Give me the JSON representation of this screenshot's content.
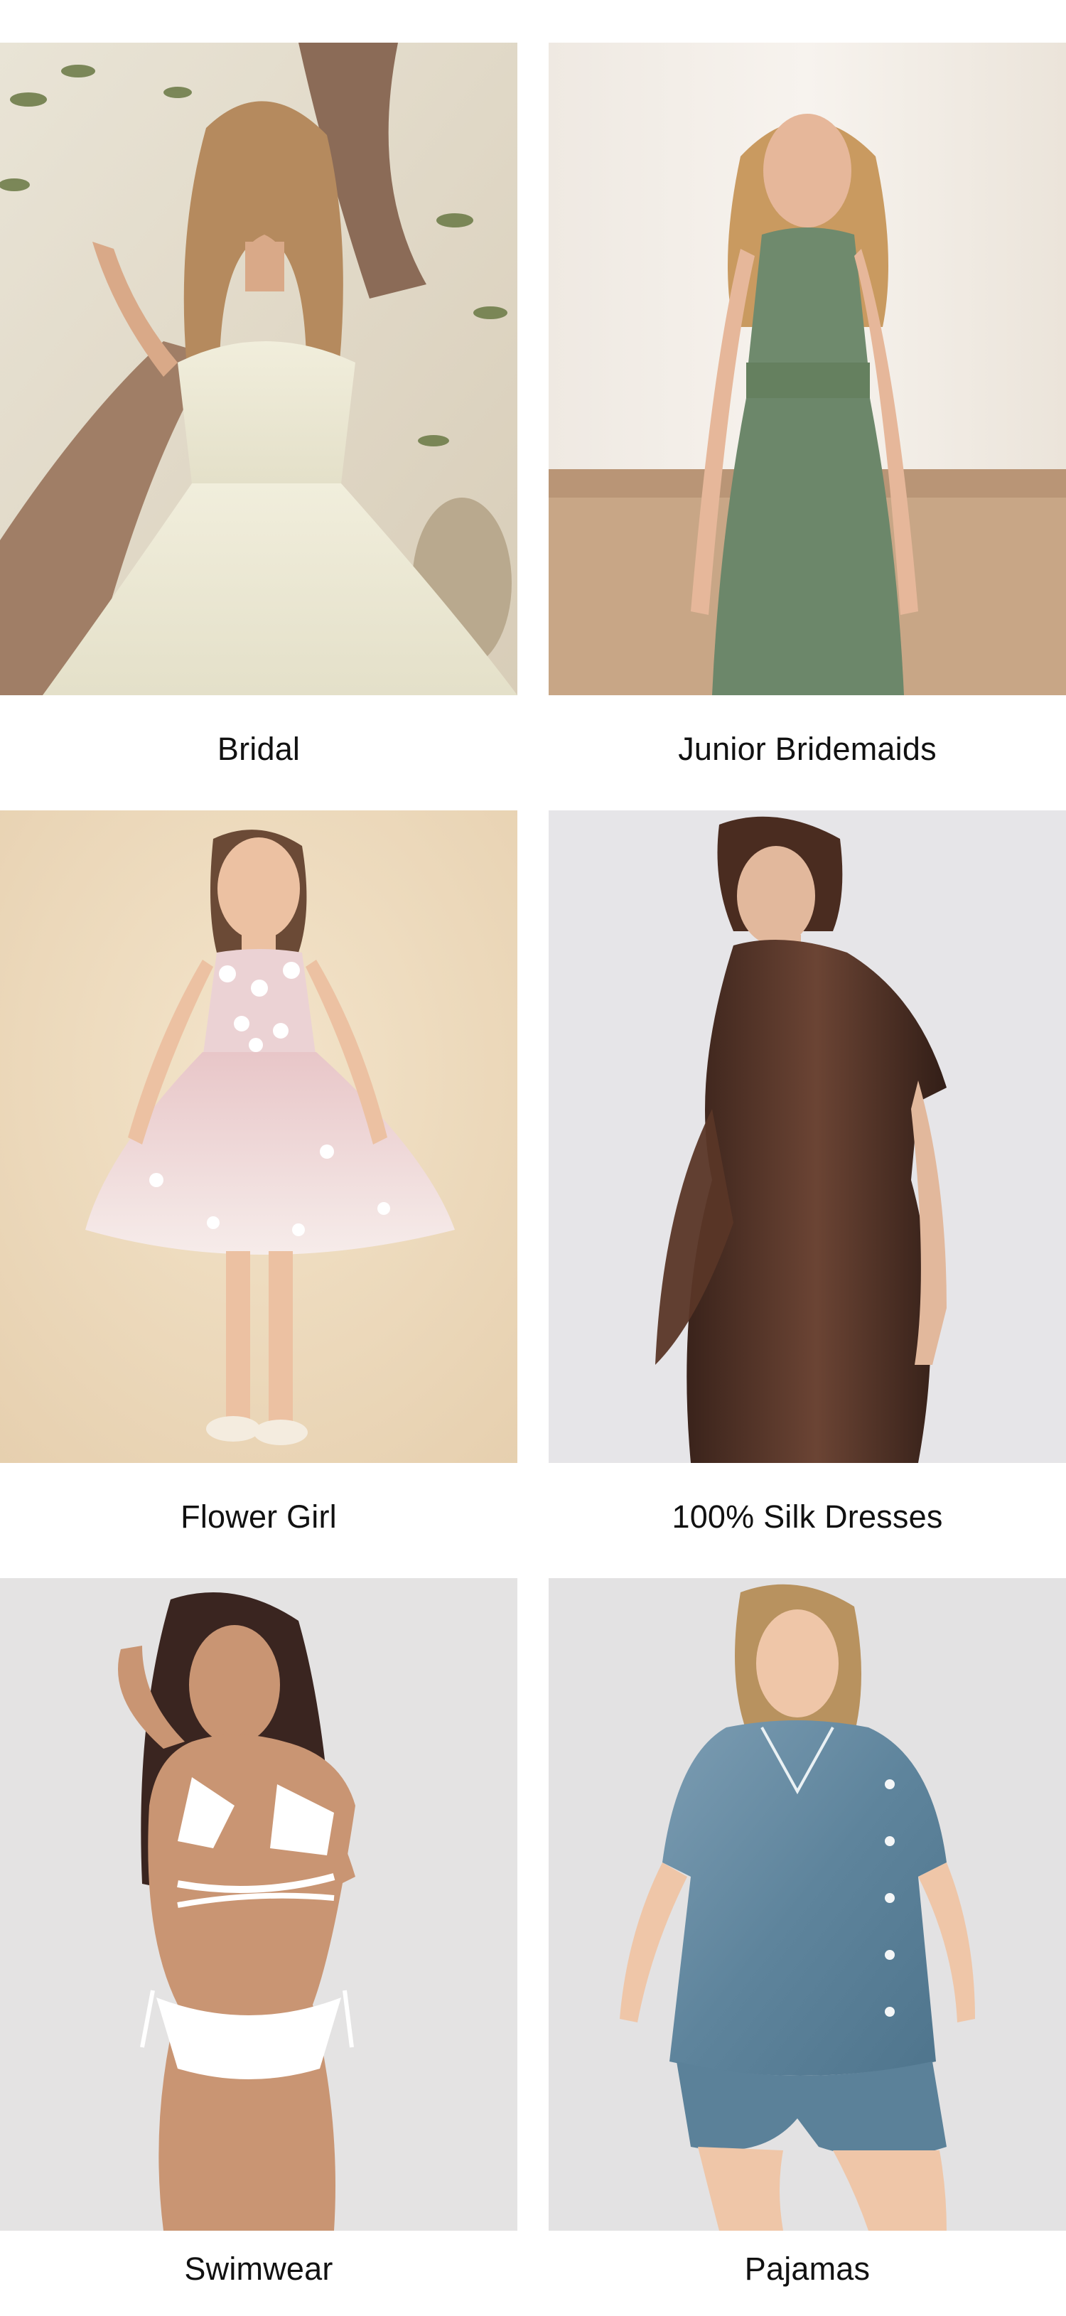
{
  "categories": [
    {
      "label": "Bridal",
      "image": "bridal-gown-photo"
    },
    {
      "label": "Junior Bridemaids",
      "image": "junior-bridesmaid-dress-photo"
    },
    {
      "label": "Flower Girl",
      "image": "flower-girl-dress-photo"
    },
    {
      "label": "100% Silk Dresses",
      "image": "silk-dress-photo"
    },
    {
      "label": "Swimwear",
      "image": "swimwear-photo"
    },
    {
      "label": "Pajamas",
      "image": "pajamas-photo"
    }
  ]
}
